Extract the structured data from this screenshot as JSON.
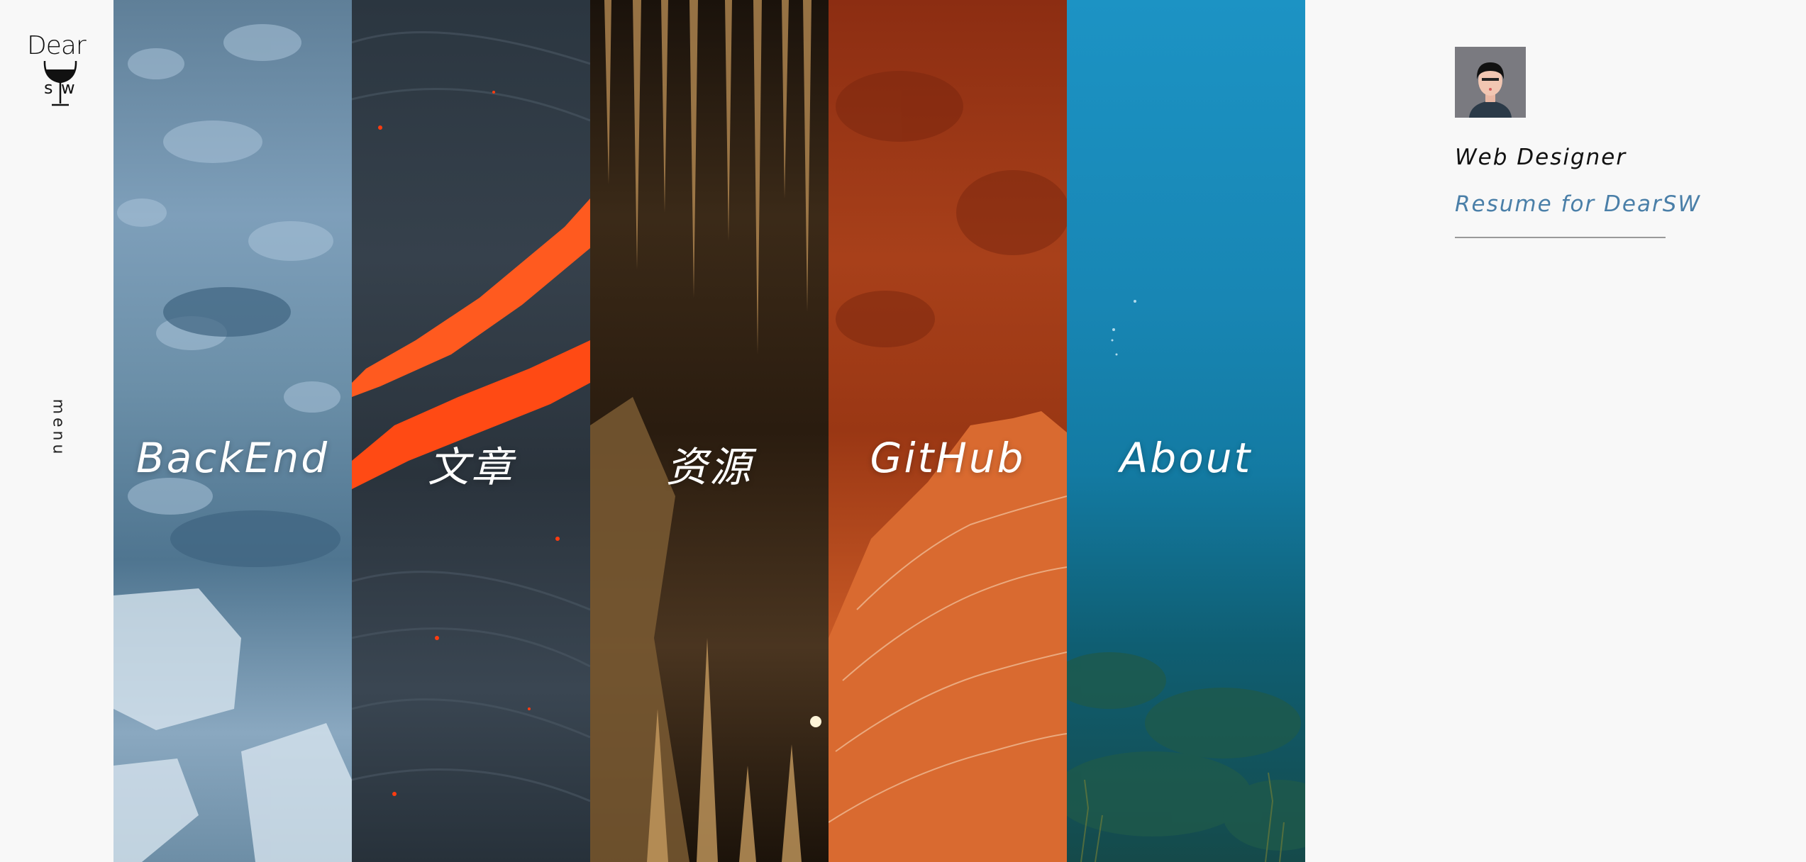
{
  "logo": {
    "top_text": "Dear",
    "left_letter": "s",
    "right_letter": "w"
  },
  "sidebar": {
    "menu_label": "menu"
  },
  "panels": [
    {
      "label": "BackEnd",
      "theme": "glacier",
      "color": "#6d8ea6"
    },
    {
      "label": "文章",
      "theme": "lava",
      "color": "#ff5a1f"
    },
    {
      "label": "资源",
      "theme": "cave",
      "color": "#3b2a18"
    },
    {
      "label": "GitHub",
      "theme": "red-rock",
      "color": "#c95a26"
    },
    {
      "label": "About",
      "theme": "ocean",
      "color": "#1886b4"
    }
  ],
  "profile": {
    "role": "Web Designer",
    "resume_link": "Resume for DearSW",
    "link_color": "#4a7fa8"
  }
}
